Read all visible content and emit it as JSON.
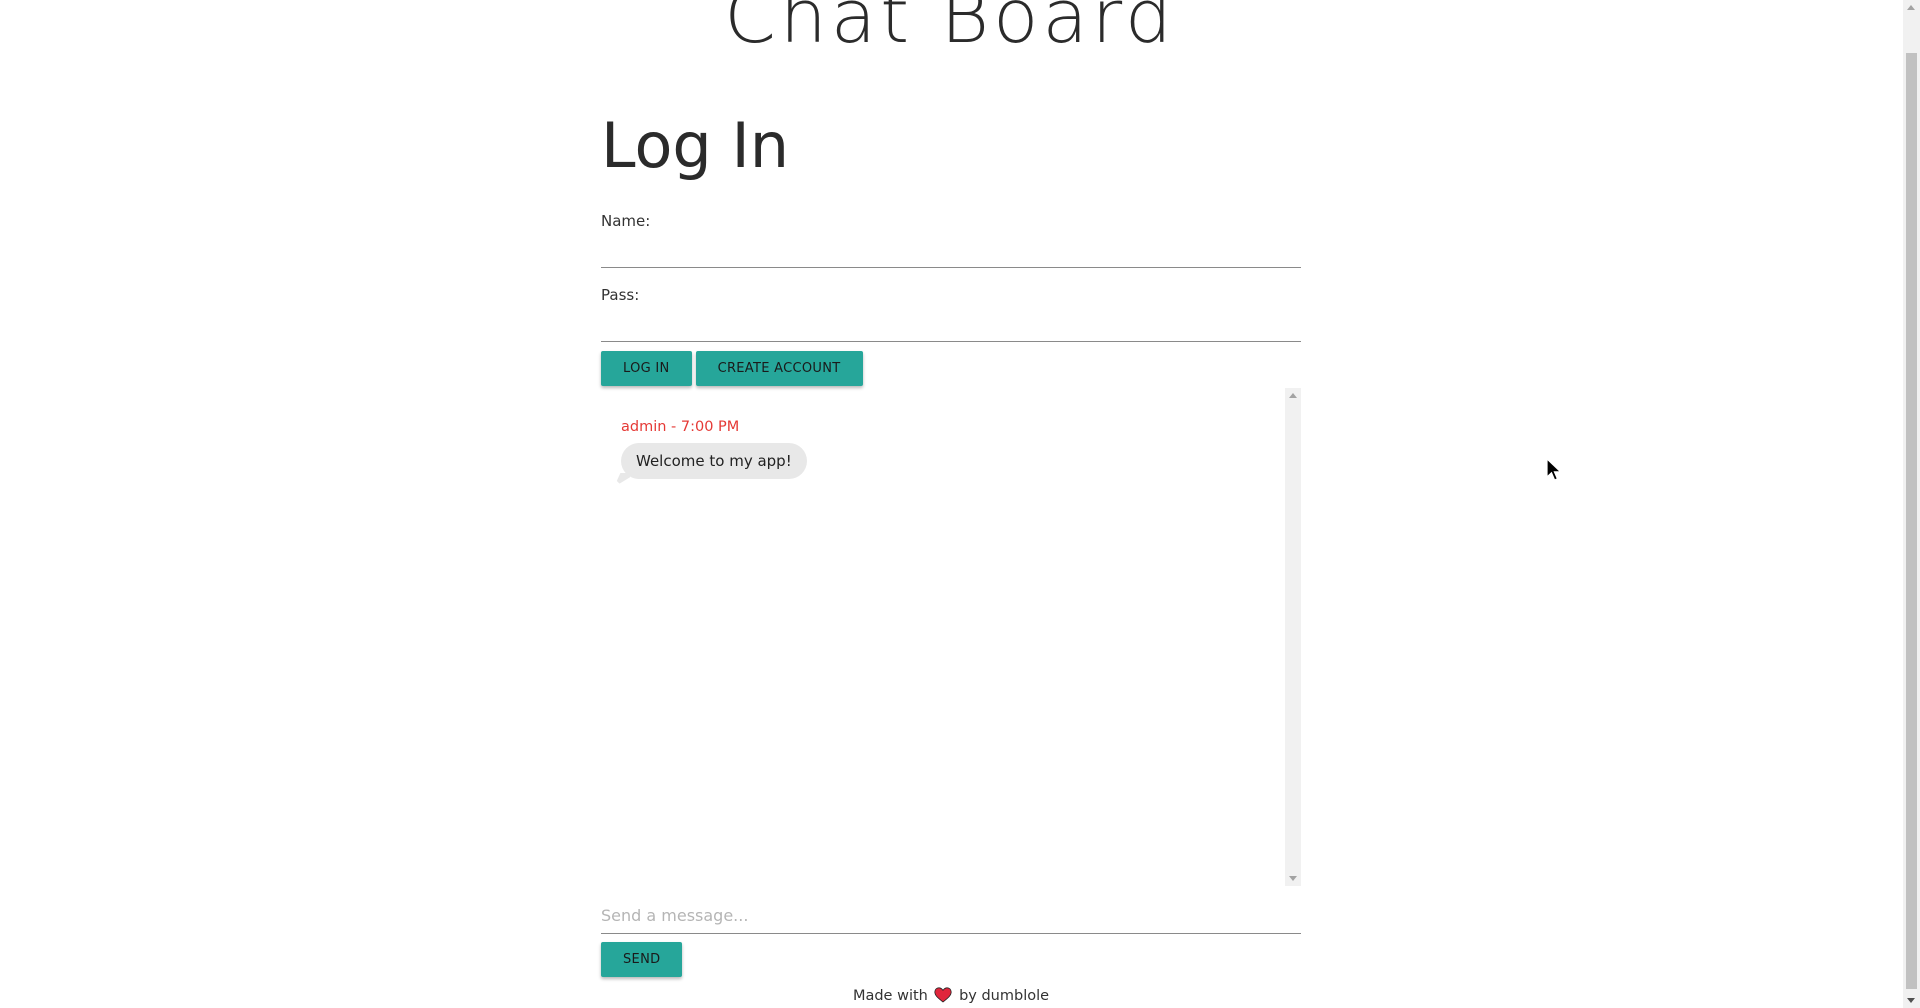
{
  "app": {
    "title": "Chat Board"
  },
  "login": {
    "heading": "Log In",
    "name_label": "Name:",
    "name_value": "",
    "pass_label": "Pass:",
    "pass_value": "",
    "login_button": "LOG IN",
    "create_account_button": "CREATE ACCOUNT"
  },
  "chat": {
    "messages": [
      {
        "meta": "admin - 7:00 PM",
        "text": "Welcome to my app!"
      }
    ],
    "input_placeholder": "Send a message...",
    "send_button": "SEND"
  },
  "footer": {
    "made_with": "Made with",
    "by": "by dumblole",
    "heart_icon": "heart-icon"
  },
  "colors": {
    "accent": "#26a69a",
    "meta_text": "#e53935",
    "bubble": "#e8e8e8",
    "heart": "#e0263c"
  }
}
